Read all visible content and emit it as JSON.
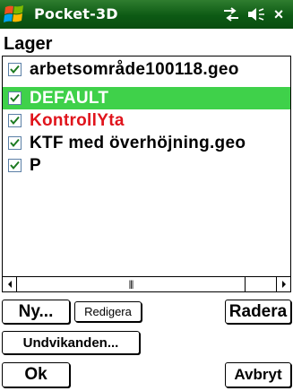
{
  "titlebar": {
    "title": "Pocket-3D",
    "start_icon": "windows-start-logo-icon",
    "connectivity_icon": "connectivity-icon",
    "volume_icon": "volume-icon",
    "close_label": "×"
  },
  "heading": "Lager",
  "layers": {
    "items": [
      {
        "label": "arbetsområde100118.geo",
        "checked": true,
        "selected": false,
        "color": "#000000"
      },
      {
        "label": "DEFAULT",
        "checked": true,
        "selected": true,
        "color": "#ffffff"
      },
      {
        "label": "KontrollYta",
        "checked": true,
        "selected": false,
        "color": "#e0141c"
      },
      {
        "label": "KTF med överhöjning.geo",
        "checked": true,
        "selected": false,
        "color": "#000000"
      },
      {
        "label": "P",
        "checked": true,
        "selected": false,
        "color": "#000000"
      }
    ]
  },
  "scrollbar": {
    "left_arrow": "◀",
    "right_arrow": "▶",
    "grip": "|||"
  },
  "buttons": {
    "new": "Ny...",
    "edit": "Redigera",
    "delete": "Radera",
    "avoidances": "Undvikanden...",
    "ok": "Ok",
    "cancel": "Avbryt"
  },
  "colors": {
    "titlebar": "#0d5a14",
    "selection": "#3fd14a",
    "highlight_text": "#e0141c"
  }
}
